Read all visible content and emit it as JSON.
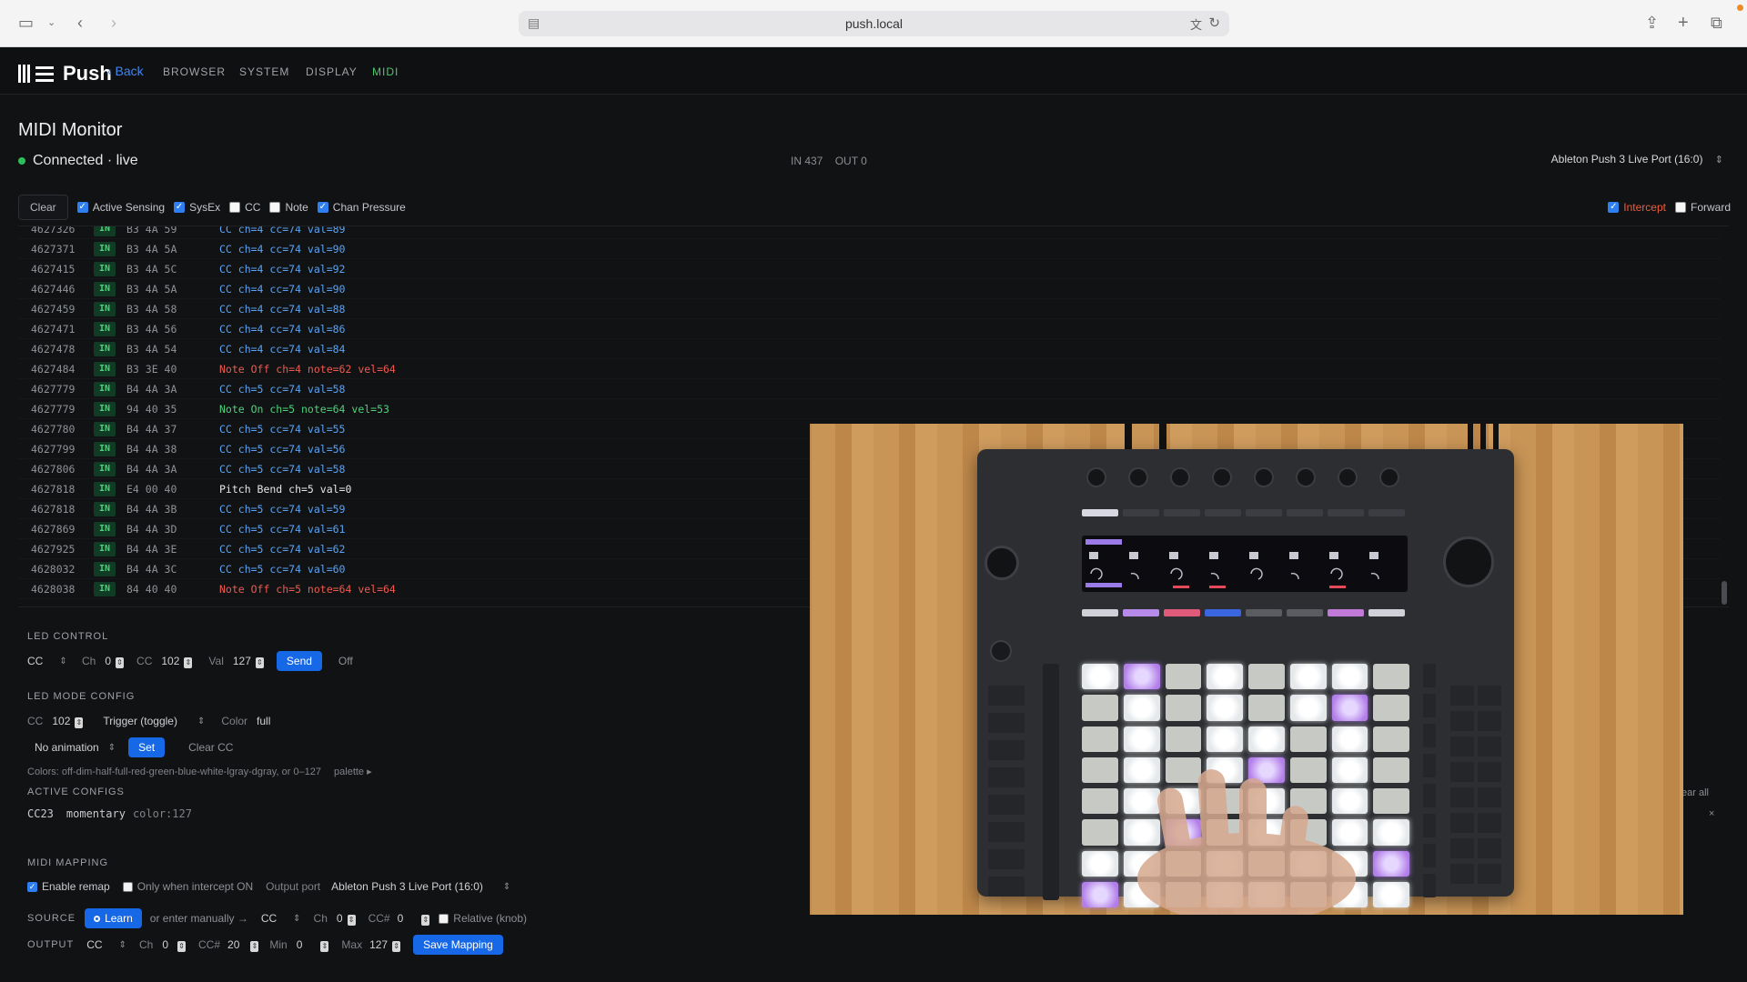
{
  "browser": {
    "url": "push.local"
  },
  "nav": {
    "brand": "Push",
    "back": "‹ Back",
    "items": [
      "BROWSER",
      "SYSTEM",
      "DISPLAY",
      "MIDI"
    ],
    "active": "MIDI"
  },
  "header": {
    "title": "MIDI Monitor",
    "status": "Connected · live",
    "in_count": "IN 437",
    "out_count": "OUT 0",
    "port": "Ableton Push 3 Live Port (16:0)"
  },
  "filters": {
    "clear": "Clear",
    "items": [
      {
        "label": "Active Sensing",
        "checked": true
      },
      {
        "label": "SysEx",
        "checked": true
      },
      {
        "label": "CC",
        "checked": false
      },
      {
        "label": "Note",
        "checked": false
      },
      {
        "label": "Chan Pressure",
        "checked": true
      }
    ],
    "intercept": {
      "label": "Intercept",
      "checked": true
    },
    "forward": {
      "label": "Forward",
      "checked": false
    }
  },
  "log": [
    {
      "ts": "4627326",
      "dir": "IN",
      "hex": "B3 4A 59",
      "msg": "CC ch=4 cc=74 val=89",
      "kind": "cc"
    },
    {
      "ts": "4627371",
      "dir": "IN",
      "hex": "B3 4A 5A",
      "msg": "CC ch=4 cc=74 val=90",
      "kind": "cc"
    },
    {
      "ts": "4627415",
      "dir": "IN",
      "hex": "B3 4A 5C",
      "msg": "CC ch=4 cc=74 val=92",
      "kind": "cc"
    },
    {
      "ts": "4627446",
      "dir": "IN",
      "hex": "B3 4A 5A",
      "msg": "CC ch=4 cc=74 val=90",
      "kind": "cc"
    },
    {
      "ts": "4627459",
      "dir": "IN",
      "hex": "B3 4A 58",
      "msg": "CC ch=4 cc=74 val=88",
      "kind": "cc"
    },
    {
      "ts": "4627471",
      "dir": "IN",
      "hex": "B3 4A 56",
      "msg": "CC ch=4 cc=74 val=86",
      "kind": "cc"
    },
    {
      "ts": "4627478",
      "dir": "IN",
      "hex": "B3 4A 54",
      "msg": "CC ch=4 cc=74 val=84",
      "kind": "cc"
    },
    {
      "ts": "4627484",
      "dir": "IN",
      "hex": "B3 3E 40",
      "msg": "Note Off ch=4 note=62 vel=64",
      "kind": "noteoff"
    },
    {
      "ts": "4627779",
      "dir": "IN",
      "hex": "B4 4A 3A",
      "msg": "CC ch=5 cc=74 val=58",
      "kind": "cc"
    },
    {
      "ts": "4627779",
      "dir": "IN",
      "hex": "94 40 35",
      "msg": "Note On ch=5 note=64 vel=53",
      "kind": "noteon"
    },
    {
      "ts": "4627780",
      "dir": "IN",
      "hex": "B4 4A 37",
      "msg": "CC ch=5 cc=74 val=55",
      "kind": "cc"
    },
    {
      "ts": "4627799",
      "dir": "IN",
      "hex": "B4 4A 38",
      "msg": "CC ch=5 cc=74 val=56",
      "kind": "cc"
    },
    {
      "ts": "4627806",
      "dir": "IN",
      "hex": "B4 4A 3A",
      "msg": "CC ch=5 cc=74 val=58",
      "kind": "cc"
    },
    {
      "ts": "4627818",
      "dir": "IN",
      "hex": "E4 00 40",
      "msg": "Pitch Bend ch=5 val=0",
      "kind": "pb"
    },
    {
      "ts": "4627818",
      "dir": "IN",
      "hex": "B4 4A 3B",
      "msg": "CC ch=5 cc=74 val=59",
      "kind": "cc"
    },
    {
      "ts": "4627869",
      "dir": "IN",
      "hex": "B4 4A 3D",
      "msg": "CC ch=5 cc=74 val=61",
      "kind": "cc"
    },
    {
      "ts": "4627925",
      "dir": "IN",
      "hex": "B4 4A 3E",
      "msg": "CC ch=5 cc=74 val=62",
      "kind": "cc"
    },
    {
      "ts": "4628032",
      "dir": "IN",
      "hex": "B4 4A 3C",
      "msg": "CC ch=5 cc=74 val=60",
      "kind": "cc"
    },
    {
      "ts": "4628038",
      "dir": "IN",
      "hex": "84 40 40",
      "msg": "Note Off ch=5 note=64 vel=64",
      "kind": "noteoff"
    }
  ],
  "led_control": {
    "title": "LED CONTROL",
    "type": "CC",
    "ch_label": "Ch",
    "ch": "0",
    "cc_label": "CC",
    "cc": "102",
    "val_label": "Val",
    "val": "127",
    "send": "Send",
    "off": "Off"
  },
  "led_mode": {
    "title": "LED MODE CONFIG",
    "cc_label": "CC",
    "cc": "102",
    "mode": "Trigger (toggle)",
    "color_label": "Color",
    "color": "full",
    "animation": "No animation",
    "set": "Set",
    "clear_cc": "Clear CC",
    "colors_hint": "Colors: off-dim-half-full-red-green-blue-white-lgray-dgray, or 0–127",
    "palette": "palette ▸",
    "active_title": "ACTIVE CONFIGS",
    "active_cc": "CC23",
    "active_mode": "momentary",
    "active_color": "color:127",
    "clear_all": "ear all",
    "close": "×"
  },
  "mapping": {
    "title": "MIDI MAPPING",
    "enable_remap": "Enable remap",
    "only_intercept": "Only when intercept ON",
    "output_port_label": "Output port",
    "output_port": "Ableton Push 3 Live Port (16:0)",
    "source_label": "SOURCE",
    "learn": "Learn",
    "or_enter": "or enter manually →",
    "src_type": "CC",
    "src_ch_label": "Ch",
    "src_ch": "0",
    "src_cc_label": "CC#",
    "src_cc": "0",
    "relative": "Relative (knob)",
    "output_label": "OUTPUT",
    "out_type": "CC",
    "out_ch_label": "Ch",
    "out_ch": "0",
    "out_cc_label": "CC#",
    "out_cc": "20",
    "min_label": "Min",
    "min": "0",
    "max_label": "Max",
    "max": "127",
    "save": "Save Mapping"
  },
  "colors": {
    "accent_blue": "#1768e6",
    "nav_active": "#4fc66e",
    "note_off": "#ee5a4f",
    "note_on": "#4ed17b",
    "cc": "#5aa3f5",
    "intercept": "#ef5b3c"
  }
}
